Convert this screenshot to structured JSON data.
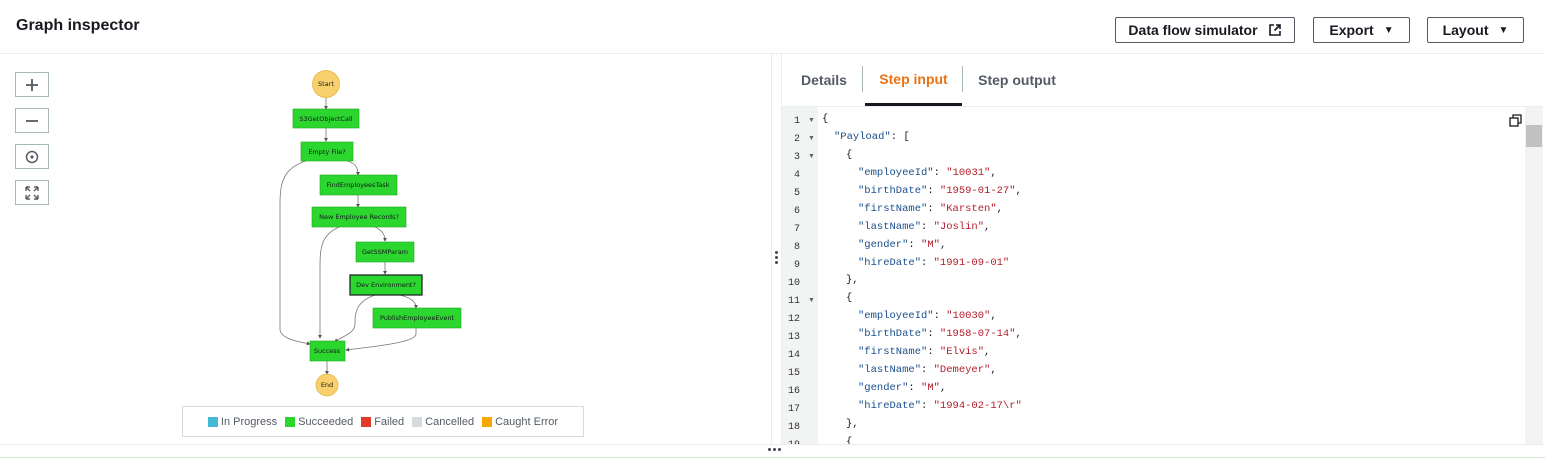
{
  "header": {
    "title": "Graph inspector",
    "data_flow_simulator": "Data flow simulator",
    "export": "Export",
    "layout": "Layout"
  },
  "graph": {
    "nodes": {
      "start": "Start",
      "s3": "S3GetObjectCall",
      "empty": "Empty File?",
      "find": "FindEmployeesTask",
      "newrec": "New Employee Records?",
      "getssm": "GetSSMParam",
      "dev": "Dev Environment?",
      "publish": "PublishEmployeeEvent",
      "success": "Success",
      "end": "End"
    },
    "legend": [
      {
        "label": "In Progress",
        "color": "#44b9d6"
      },
      {
        "label": "Succeeded",
        "color": "#2bd62e"
      },
      {
        "label": "Failed",
        "color": "#e13b2b"
      },
      {
        "label": "Cancelled",
        "color": "#d5dbdb"
      },
      {
        "label": "Caught Error",
        "color": "#f6a800"
      }
    ]
  },
  "tabs": {
    "details": "Details",
    "step_input": "Step input",
    "step_output": "Step output"
  },
  "editor": {
    "lines": [
      {
        "n": "1",
        "fold": true
      },
      {
        "n": "2",
        "fold": true
      },
      {
        "n": "3",
        "fold": true
      },
      {
        "n": "4"
      },
      {
        "n": "5"
      },
      {
        "n": "6"
      },
      {
        "n": "7"
      },
      {
        "n": "8"
      },
      {
        "n": "9"
      },
      {
        "n": "10"
      },
      {
        "n": "11",
        "fold": true
      },
      {
        "n": "12"
      },
      {
        "n": "13"
      },
      {
        "n": "14"
      },
      {
        "n": "15"
      },
      {
        "n": "16"
      },
      {
        "n": "17"
      },
      {
        "n": "18"
      },
      {
        "n": "19"
      }
    ],
    "code": {
      "l1": "{",
      "l2k": "\"Payload\"",
      "l2p": ": [",
      "l3": "{",
      "r1": [
        {
          "k": "\"employeeId\"",
          "v": "\"10031\"",
          "c": ","
        },
        {
          "k": "\"birthDate\"",
          "v": "\"1959-01-27\"",
          "c": ","
        },
        {
          "k": "\"firstName\"",
          "v": "\"Karsten\"",
          "c": ","
        },
        {
          "k": "\"lastName\"",
          "v": "\"Joslin\"",
          "c": ","
        },
        {
          "k": "\"gender\"",
          "v": "\"M\"",
          "c": ","
        },
        {
          "k": "\"hireDate\"",
          "v": "\"1991-09-01\"",
          "c": ""
        }
      ],
      "l10": "},",
      "l11": "{",
      "r2": [
        {
          "k": "\"employeeId\"",
          "v": "\"10030\"",
          "c": ","
        },
        {
          "k": "\"birthDate\"",
          "v": "\"1958-07-14\"",
          "c": ","
        },
        {
          "k": "\"firstName\"",
          "v": "\"Elvis\"",
          "c": ","
        },
        {
          "k": "\"lastName\"",
          "v": "\"Demeyer\"",
          "c": ","
        },
        {
          "k": "\"gender\"",
          "v": "\"M\"",
          "c": ","
        },
        {
          "k": "\"hireDate\"",
          "v": "\"1994-02-17\\r\"",
          "c": ""
        }
      ],
      "l18": "},",
      "l19": "{"
    }
  }
}
